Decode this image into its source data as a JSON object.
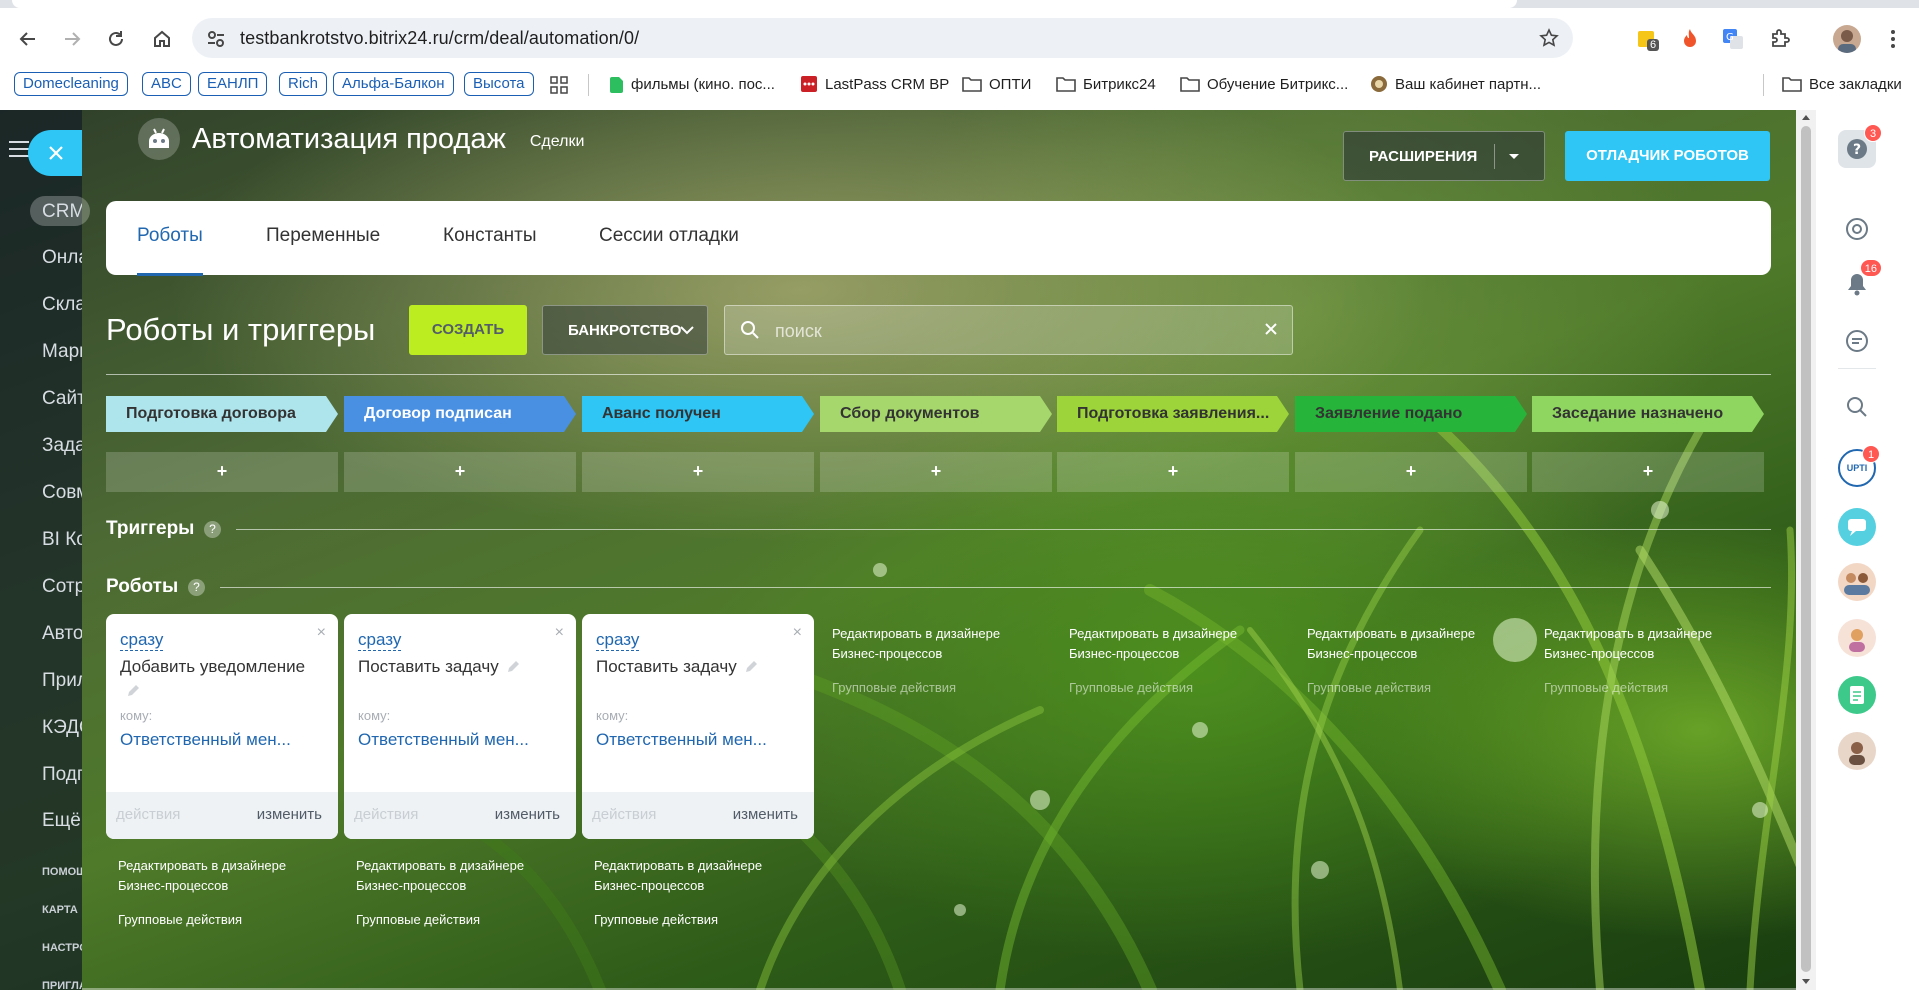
{
  "browser": {
    "url": "testbankrotstvo.bitrix24.ru/crm/deal/automation/0/",
    "ext_badge": "6",
    "bookmarks_pills": [
      "Domecleaning",
      "ABC",
      "ЕАНЛП",
      "Rich",
      "Альфа-Балкон",
      "Высота"
    ],
    "bookmarks_folders": [
      "фильмы (кино. пос...",
      "LastPass CRM BP",
      "ОПТИ",
      "Битрикс24",
      "Обучение Битрикс...",
      "Ваш кабинет партн..."
    ],
    "all_bookmarks": "Все закладки"
  },
  "left_menu": {
    "items": [
      "CRM",
      "Онлайн",
      "Склад",
      "Маркетинг",
      "Сайты",
      "Задачи",
      "Совместная",
      "BI Конструктор",
      "Сотрудники",
      "Автоматизация",
      "Приложения",
      "КЭДО",
      "Подписки",
      "Ещё"
    ],
    "small": [
      "ПОМОЩЬ",
      "КАРТА",
      "НАСТРОЙКИ",
      "ПРИГЛАСИТЬ"
    ]
  },
  "right_bar": {
    "help_badge": "3",
    "bell_badge": "16",
    "app_badge": "1",
    "app_label": "UPTI"
  },
  "header": {
    "title": "Автоматизация продаж",
    "subtitle": "Сделки",
    "extensions_label": "РАСШИРЕНИЯ",
    "debugger_label": "ОТЛАДЧИК РОБОТОВ"
  },
  "tabs": [
    "Роботы",
    "Переменные",
    "Константы",
    "Сессии отладки"
  ],
  "toolbar": {
    "section_title": "Роботы и триггеры",
    "create_label": "СОЗДАТЬ",
    "category_label": "БАНКРОТСТВО",
    "search_placeholder": "поиск"
  },
  "stages": [
    {
      "name": "Подготовка договора",
      "color": "#aee5ec"
    },
    {
      "name": "Договор подписан",
      "color": "#4a90e2"
    },
    {
      "name": "Аванс получен",
      "color": "#2fc6f6"
    },
    {
      "name": "Сбор документов",
      "color": "#a6d76c"
    },
    {
      "name": "Подготовка заявления...",
      "color": "#9cd43a"
    },
    {
      "name": "Заявление подано",
      "color": "#26b43a"
    },
    {
      "name": "Заседание назначено",
      "color": "#8fd660"
    }
  ],
  "plus_label": "+",
  "triggers_title": "Триггеры",
  "robots_title": "Роботы",
  "robots": [
    {
      "when": "сразу",
      "title": "Добавить уведомление",
      "to_label": "кому:",
      "to": "Ответственный мен...",
      "actions": "действия",
      "edit": "изменить"
    },
    {
      "when": "сразу",
      "title": "Поставить задачу",
      "to_label": "кому:",
      "to": "Ответственный мен...",
      "actions": "действия",
      "edit": "изменить"
    },
    {
      "when": "сразу",
      "title": "Поставить задачу",
      "to_label": "кому:",
      "to": "Ответственный мен...",
      "actions": "действия",
      "edit": "изменить"
    }
  ],
  "links": {
    "designer": "Редактировать в дизайнере Бизнес-процессов",
    "group": "Групповые действия"
  }
}
